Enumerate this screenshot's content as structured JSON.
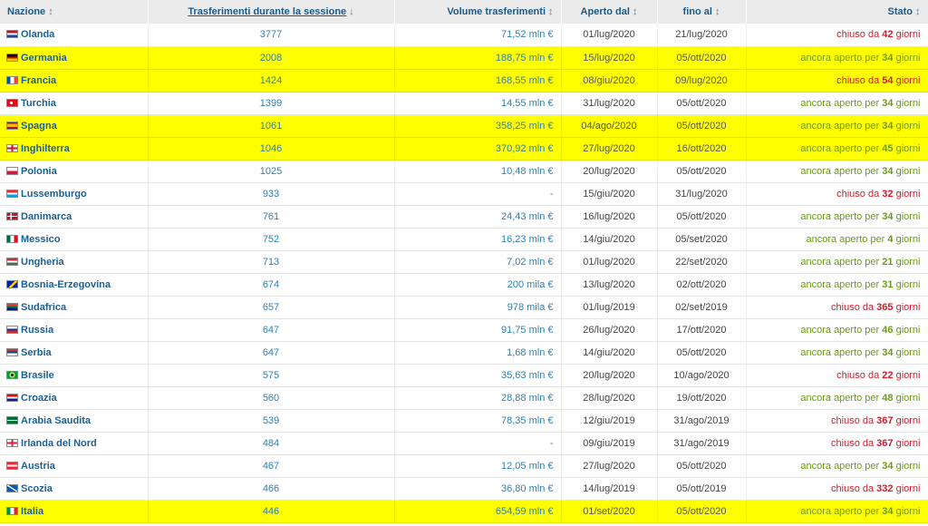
{
  "headers": {
    "nation": "Nazione",
    "transfers": "Trasferimenti durante la sessione",
    "volume": "Volume trasferimenti",
    "open_from": "Aperto dal",
    "until": "fino al",
    "status": "Stato",
    "sort_icon": "↕",
    "sort_active_icon": "↓"
  },
  "status_words": {
    "closed_prefix": "chiuso da",
    "open_prefix": "ancora aperto per",
    "days": "giorni"
  },
  "colors": {
    "highlight": "#ffff00",
    "link": "#2f7fb0",
    "closed": "#d11d2b",
    "open": "#6a9a16",
    "header_bg": "#ebebeb"
  },
  "rows": [
    {
      "nation": "Olanda",
      "flag": "netherlands-flag",
      "transfers": "3777",
      "volume": "71,52 mln €",
      "open_from": "01/lug/2020",
      "until": "21/lug/2020",
      "status": "closed",
      "days": "42",
      "highlight": false
    },
    {
      "nation": "Germania",
      "flag": "germany-flag",
      "transfers": "2008",
      "volume": "188,75 mln €",
      "open_from": "15/lug/2020",
      "until": "05/ott/2020",
      "status": "open",
      "days": "34",
      "highlight": true
    },
    {
      "nation": "Francia",
      "flag": "france-flag",
      "transfers": "1424",
      "volume": "168,55 mln €",
      "open_from": "08/giu/2020",
      "until": "09/lug/2020",
      "status": "closed",
      "days": "54",
      "highlight": true
    },
    {
      "nation": "Turchia",
      "flag": "turkey-flag",
      "transfers": "1399",
      "volume": "14,55 mln €",
      "open_from": "31/lug/2020",
      "until": "05/ott/2020",
      "status": "open",
      "days": "34",
      "highlight": false
    },
    {
      "nation": "Spagna",
      "flag": "spain-flag",
      "transfers": "1061",
      "volume": "358,25 mln €",
      "open_from": "04/ago/2020",
      "until": "05/ott/2020",
      "status": "open",
      "days": "34",
      "highlight": true
    },
    {
      "nation": "Inghilterra",
      "flag": "england-flag",
      "transfers": "1046",
      "volume": "370,92 mln €",
      "open_from": "27/lug/2020",
      "until": "16/ott/2020",
      "status": "open",
      "days": "45",
      "highlight": true
    },
    {
      "nation": "Polonia",
      "flag": "poland-flag",
      "transfers": "1025",
      "volume": "10,48 mln €",
      "open_from": "20/lug/2020",
      "until": "05/ott/2020",
      "status": "open",
      "days": "34",
      "highlight": false
    },
    {
      "nation": "Lussemburgo",
      "flag": "luxembourg-flag",
      "transfers": "933",
      "volume": "-",
      "open_from": "15/giu/2020",
      "until": "31/lug/2020",
      "status": "closed",
      "days": "32",
      "highlight": false
    },
    {
      "nation": "Danimarca",
      "flag": "denmark-flag",
      "transfers": "761",
      "volume": "24,43 mln €",
      "open_from": "16/lug/2020",
      "until": "05/ott/2020",
      "status": "open",
      "days": "34",
      "highlight": false
    },
    {
      "nation": "Messico",
      "flag": "mexico-flag",
      "transfers": "752",
      "volume": "16,23 mln €",
      "open_from": "14/giu/2020",
      "until": "05/set/2020",
      "status": "open",
      "days": "4",
      "highlight": false
    },
    {
      "nation": "Ungheria",
      "flag": "hungary-flag",
      "transfers": "713",
      "volume": "7,02 mln €",
      "open_from": "01/lug/2020",
      "until": "22/set/2020",
      "status": "open",
      "days": "21",
      "highlight": false
    },
    {
      "nation": "Bosnia-Erzegovina",
      "flag": "bosnia-flag",
      "transfers": "674",
      "volume": "200 mila €",
      "open_from": "13/lug/2020",
      "until": "02/ott/2020",
      "status": "open",
      "days": "31",
      "highlight": false
    },
    {
      "nation": "Sudafrica",
      "flag": "south-africa-flag",
      "transfers": "657",
      "volume": "978 mila €",
      "open_from": "01/lug/2019",
      "until": "02/set/2019",
      "status": "closed",
      "days": "365",
      "highlight": false
    },
    {
      "nation": "Russia",
      "flag": "russia-flag",
      "transfers": "647",
      "volume": "91,75 mln €",
      "open_from": "26/lug/2020",
      "until": "17/ott/2020",
      "status": "open",
      "days": "46",
      "highlight": false
    },
    {
      "nation": "Serbia",
      "flag": "serbia-flag",
      "transfers": "647",
      "volume": "1,68 mln €",
      "open_from": "14/giu/2020",
      "until": "05/ott/2020",
      "status": "open",
      "days": "34",
      "highlight": false
    },
    {
      "nation": "Brasile",
      "flag": "brazil-flag",
      "transfers": "575",
      "volume": "35,63 mln €",
      "open_from": "20/lug/2020",
      "until": "10/ago/2020",
      "status": "closed",
      "days": "22",
      "highlight": false
    },
    {
      "nation": "Croazia",
      "flag": "croatia-flag",
      "transfers": "560",
      "volume": "28,88 mln €",
      "open_from": "28/lug/2020",
      "until": "19/ott/2020",
      "status": "open",
      "days": "48",
      "highlight": false
    },
    {
      "nation": "Arabia Saudita",
      "flag": "saudi-arabia-flag",
      "transfers": "539",
      "volume": "78,35 mln €",
      "open_from": "12/giu/2019",
      "until": "31/ago/2019",
      "status": "closed",
      "days": "367",
      "highlight": false
    },
    {
      "nation": "Irlanda del Nord",
      "flag": "northern-ireland-flag",
      "transfers": "484",
      "volume": "-",
      "open_from": "09/giu/2019",
      "until": "31/ago/2019",
      "status": "closed",
      "days": "367",
      "highlight": false
    },
    {
      "nation": "Austria",
      "flag": "austria-flag",
      "transfers": "467",
      "volume": "12,05 mln €",
      "open_from": "27/lug/2020",
      "until": "05/ott/2020",
      "status": "open",
      "days": "34",
      "highlight": false
    },
    {
      "nation": "Scozia",
      "flag": "scotland-flag",
      "transfers": "466",
      "volume": "36,80 mln €",
      "open_from": "14/lug/2019",
      "until": "05/ott/2019",
      "status": "closed",
      "days": "332",
      "highlight": false
    },
    {
      "nation": "Italia",
      "flag": "italy-flag",
      "transfers": "446",
      "volume": "654,59 mln €",
      "open_from": "01/set/2020",
      "until": "05/ott/2020",
      "status": "open",
      "days": "34",
      "highlight": true
    }
  ]
}
